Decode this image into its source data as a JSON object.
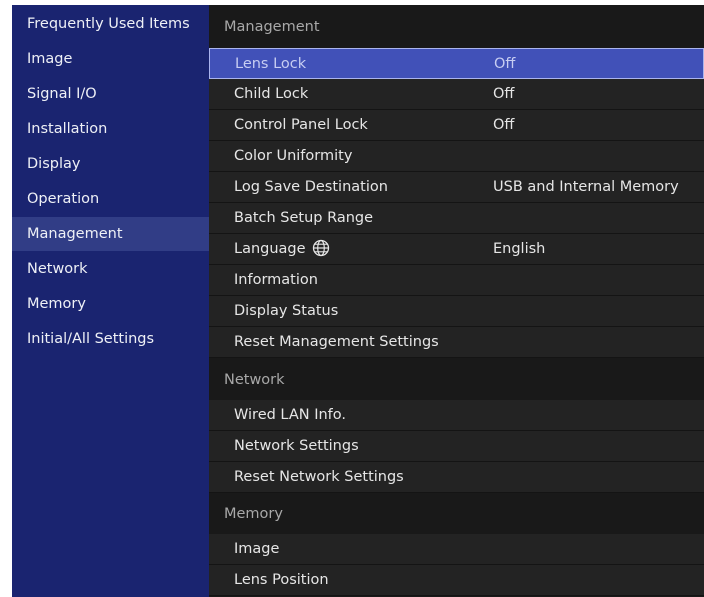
{
  "sidebar": {
    "items": [
      {
        "label": "Frequently Used Items"
      },
      {
        "label": "Image"
      },
      {
        "label": "Signal I/O"
      },
      {
        "label": "Installation"
      },
      {
        "label": "Display"
      },
      {
        "label": "Operation"
      },
      {
        "label": "Management"
      },
      {
        "label": "Network"
      },
      {
        "label": "Memory"
      },
      {
        "label": "Initial/All Settings"
      }
    ],
    "active_item": "Management"
  },
  "main": {
    "management": {
      "header": "Management",
      "items": [
        {
          "label": "Lens Lock",
          "value": "Off"
        },
        {
          "label": "Child Lock",
          "value": "Off"
        },
        {
          "label": "Control Panel Lock",
          "value": "Off"
        },
        {
          "label": "Color Uniformity",
          "value": ""
        },
        {
          "label": "Log Save Destination",
          "value": "USB and Internal Memory"
        },
        {
          "label": "Batch Setup Range",
          "value": ""
        },
        {
          "label": "Language",
          "value": "English",
          "icon": "globe-icon"
        },
        {
          "label": "Information",
          "value": ""
        },
        {
          "label": "Display Status",
          "value": ""
        },
        {
          "label": "Reset Management Settings",
          "value": ""
        }
      ]
    },
    "network": {
      "header": "Network",
      "items": [
        {
          "label": "Wired LAN Info."
        },
        {
          "label": "Network Settings"
        },
        {
          "label": "Reset Network Settings"
        }
      ]
    },
    "memory": {
      "header": "Memory",
      "items": [
        {
          "label": "Image"
        },
        {
          "label": "Lens Position"
        }
      ]
    },
    "selected_item": "Lens Lock"
  },
  "colors": {
    "sidebar_bg": "#1a2470",
    "sidebar_active_bg": "#313d86",
    "panel_bg": "#191919",
    "row_bg": "#232323",
    "selected_bg": "#4151b8",
    "selected_border": "#aab4ee",
    "header_text": "#a8a8a8",
    "text": "#e6e6e6"
  }
}
